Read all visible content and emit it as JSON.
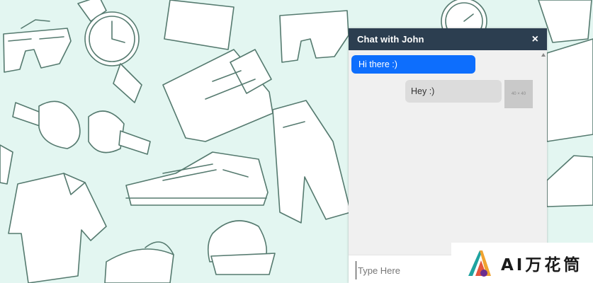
{
  "chat": {
    "title": "Chat with John",
    "close_symbol": "×",
    "messages": [
      {
        "direction": "incoming",
        "text": "Hi there :)"
      },
      {
        "direction": "outgoing",
        "text": "Hey :)",
        "avatar_label": "40 × 40"
      }
    ],
    "input_placeholder": "Type Here"
  },
  "watermark": {
    "text": "AI万花筒"
  },
  "colors": {
    "header": "#2c3e50",
    "incoming_bubble": "#0d6efd",
    "outgoing_bubble": "#dcdcdc",
    "background": "#e3f6f1"
  }
}
